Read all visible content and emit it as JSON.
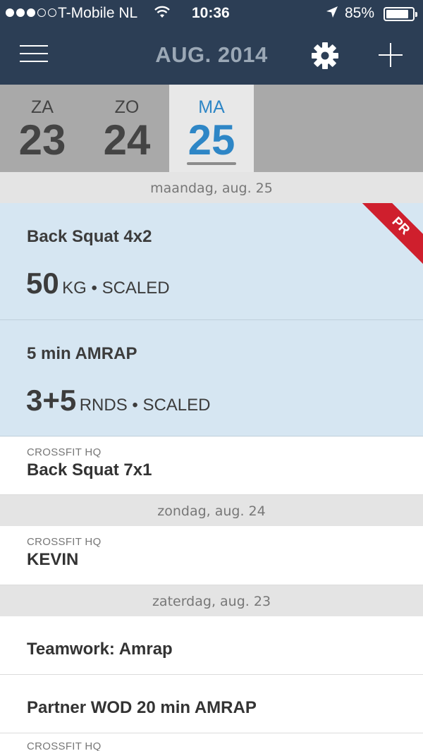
{
  "status": {
    "carrier": "T-Mobile NL",
    "time": "10:36",
    "battery": "85%",
    "battery_level": 0.85
  },
  "nav": {
    "title": "AUG. 2014"
  },
  "days": [
    {
      "name": "ZA",
      "num": "23"
    },
    {
      "name": "ZO",
      "num": "24"
    },
    {
      "name": "MA",
      "num": "25",
      "active": true
    }
  ],
  "sections": {
    "mon": "maandag, aug. 25",
    "sun": "zondag, aug. 24",
    "sat": "zaterdag, aug. 23"
  },
  "results": [
    {
      "name": "Back Squat 4x2",
      "value": "50",
      "unit": "KG • SCALED",
      "badge": "PR"
    },
    {
      "name": "5 min AMRAP",
      "value": "3+5",
      "unit": "RNDS • SCALED"
    }
  ],
  "workouts": [
    {
      "gym": "CROSSFIT HQ",
      "title": "Back Squat 7x1"
    },
    {
      "gym": "CROSSFIT HQ",
      "title": "KEVIN"
    },
    {
      "title": "Teamwork: Amrap"
    },
    {
      "title": "Partner WOD 20 min AMRAP"
    },
    {
      "gym": "CROSSFIT HQ"
    }
  ],
  "colors": {
    "navbar": "#2c3e55",
    "accent": "#2e86c6",
    "result_bg": "#d6e6f2",
    "pr_badge": "#cf1f2d"
  }
}
